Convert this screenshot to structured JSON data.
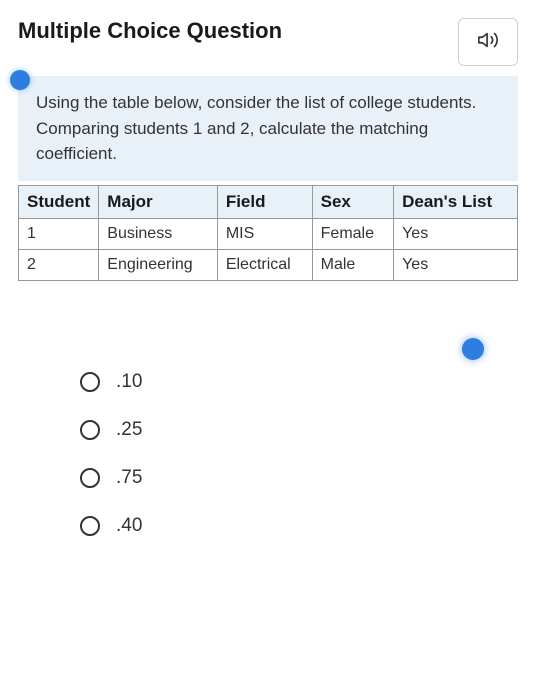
{
  "header": {
    "title": "Multiple Choice Question"
  },
  "question": {
    "prompt": "Using the table below, consider the list of college students. Comparing students 1 and 2, calculate the matching coefficient."
  },
  "table": {
    "headers": {
      "col0": "Student",
      "col1": "Major",
      "col2": "Field",
      "col3": "Sex",
      "col4": "Dean's List"
    },
    "rows": [
      {
        "col0": "1",
        "col1": "Business",
        "col2": "MIS",
        "col3": "Female",
        "col4": "Yes"
      },
      {
        "col0": "2",
        "col1": "Engineering",
        "col2": "Electrical",
        "col3": "Male",
        "col4": "Yes"
      }
    ]
  },
  "options": [
    {
      "label": ".10"
    },
    {
      "label": ".25"
    },
    {
      "label": ".75"
    },
    {
      "label": ".40"
    }
  ]
}
